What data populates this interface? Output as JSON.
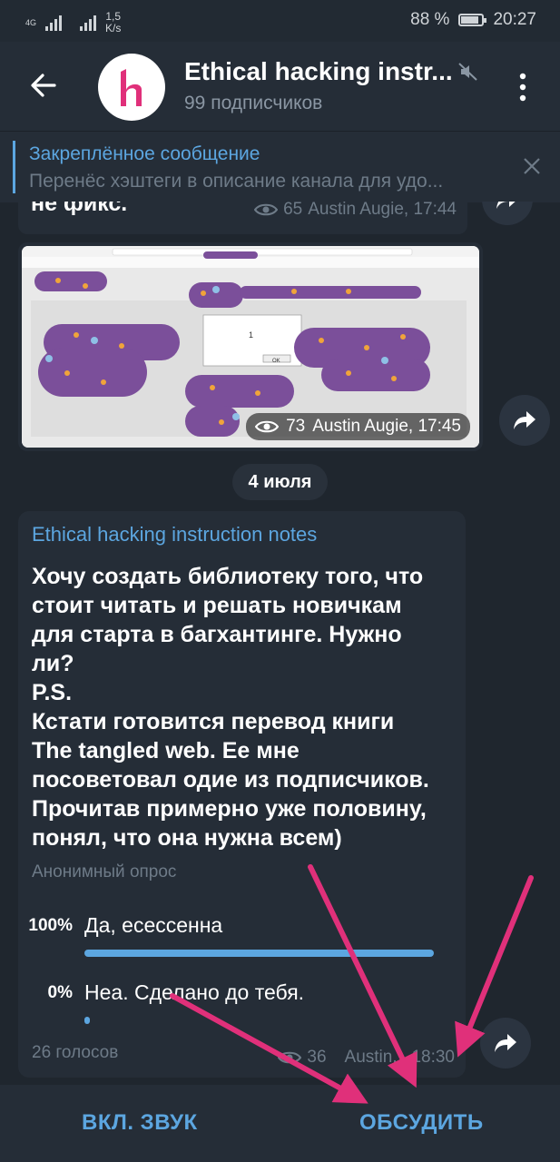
{
  "status_bar": {
    "network": "4G",
    "speed_value": "1,5",
    "speed_unit": "K/s",
    "battery": "88 %",
    "battery_level": 0.88,
    "time": "20:27"
  },
  "header": {
    "title": "Ethical hacking instr...",
    "subtitle": "99 подписчиков",
    "icons": [
      "back-arrow-icon",
      "channel-logo",
      "muted-icon",
      "more-vert-icon"
    ]
  },
  "pinned": {
    "title": "Закреплённое сообщение",
    "text": "Перенёс хэштеги в описание канала для удо..."
  },
  "messages": {
    "text_tail": {
      "text": "не фикс.",
      "views": "65",
      "author_time": "Austin Augie, 17:44"
    },
    "photo": {
      "views": "73",
      "author_time": "Austin Augie, 17:45",
      "dialog_value": "1",
      "dialog_button": "OK"
    }
  },
  "date_separator": "4 июля",
  "poll": {
    "channel": "Ethical hacking instruction notes",
    "question_lines": [
      "Хочу создать библиотеку того, что",
      "стоит читать и решать новичкам",
      "для старта в багхантинге. Нужно",
      "ли?",
      "P.S.",
      "Кстати готовится перевод книги",
      "The tangled web. Ее мне",
      "посоветовал одие из подписчиков.",
      "Прочитав примерно уже половину,",
      "понял, что она нужна всем)"
    ],
    "type_label": "Анонимный опрос",
    "options": [
      {
        "percent": "100%",
        "text": "Да, есессенна",
        "share": 1.0
      },
      {
        "percent": "0%",
        "text": "Неа. Сделано до тебя.",
        "share": 0.0
      }
    ],
    "votes": "26 голосов",
    "views": "36",
    "author_time": "Austin... 18:30"
  },
  "bottom_bar": {
    "left_label": "ВКЛ. ЗВУК",
    "right_label": "ОБСУДИТЬ"
  },
  "colors": {
    "accent": "#5ca6e0",
    "background": "#1f262e",
    "surface": "#252d37",
    "annotation_arrow": "#e0307a"
  }
}
